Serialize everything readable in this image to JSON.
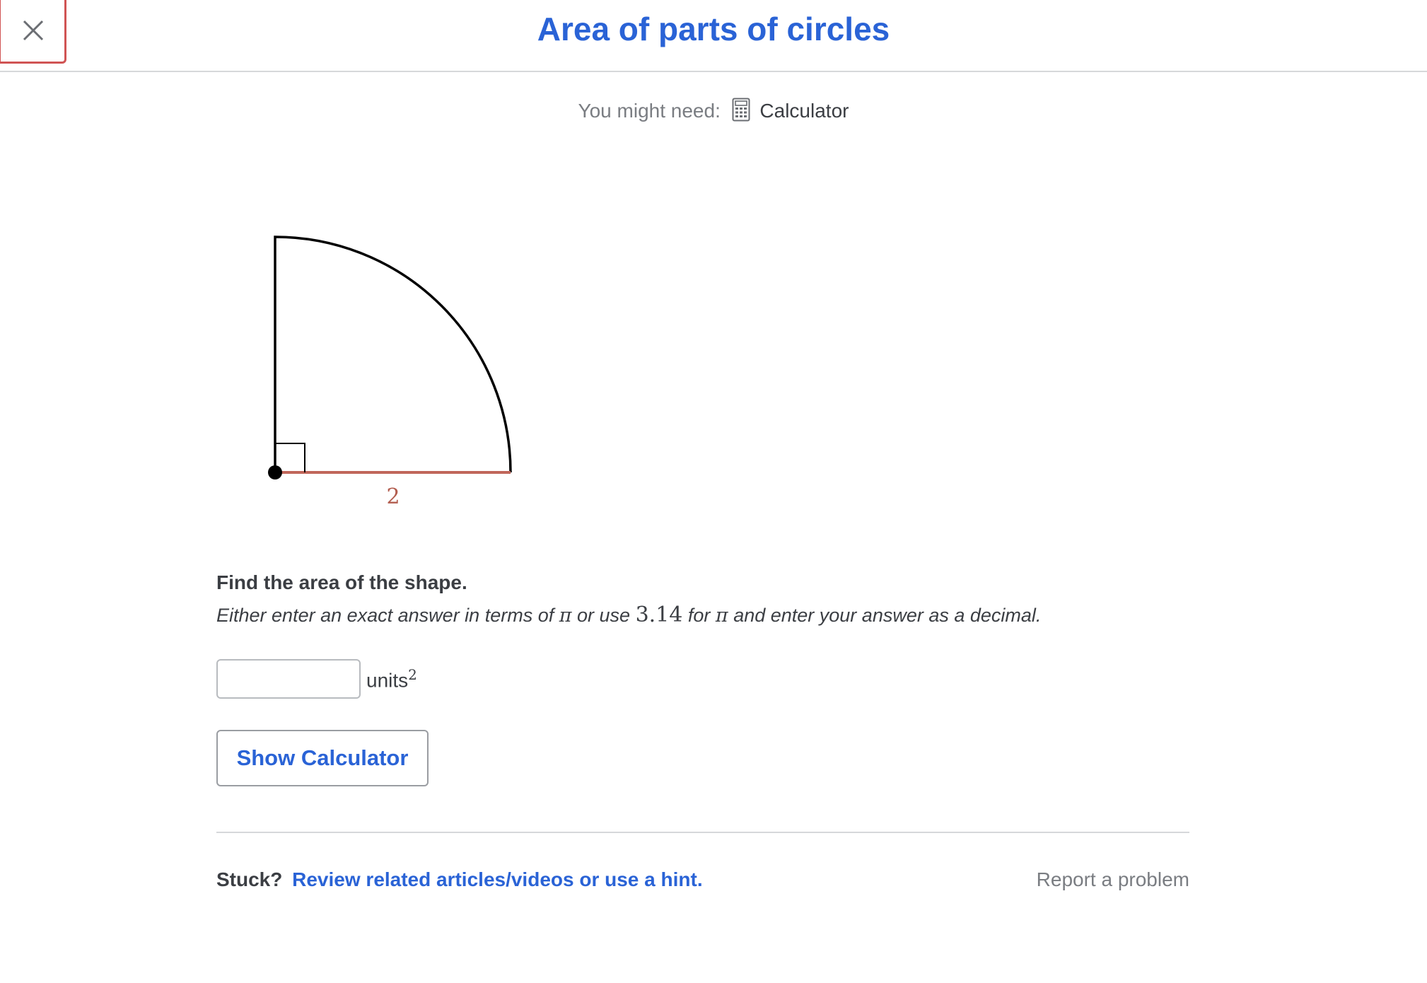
{
  "header": {
    "title": "Area of parts of circles",
    "close_icon": "close-icon"
  },
  "tools": {
    "prefix": "You might need:",
    "calculator_label": "Calculator",
    "calculator_icon": "calculator-icon"
  },
  "figure": {
    "shape": "quarter-circle",
    "radius_label": "2",
    "radius_color": "#c0665a",
    "right_angle_marker": true
  },
  "question": {
    "prompt": "Find the area of the shape.",
    "instruction_part1": "Either enter an exact answer in terms of",
    "pi_symbol": "π",
    "instruction_part2": "or use",
    "pi_value": "3.14",
    "instruction_part3": "for",
    "instruction_part4": "and enter your answer as a decimal."
  },
  "answer": {
    "value": "",
    "placeholder": "",
    "units": "units",
    "units_exponent": "2"
  },
  "buttons": {
    "show_calculator": "Show Calculator"
  },
  "footer": {
    "stuck": "Stuck?",
    "hint_link": "Review related articles/videos or use a hint.",
    "report": "Report a problem"
  },
  "colors": {
    "accent": "#2a63d6",
    "close_border": "#d05454",
    "muted_text": "#7a7d82"
  }
}
